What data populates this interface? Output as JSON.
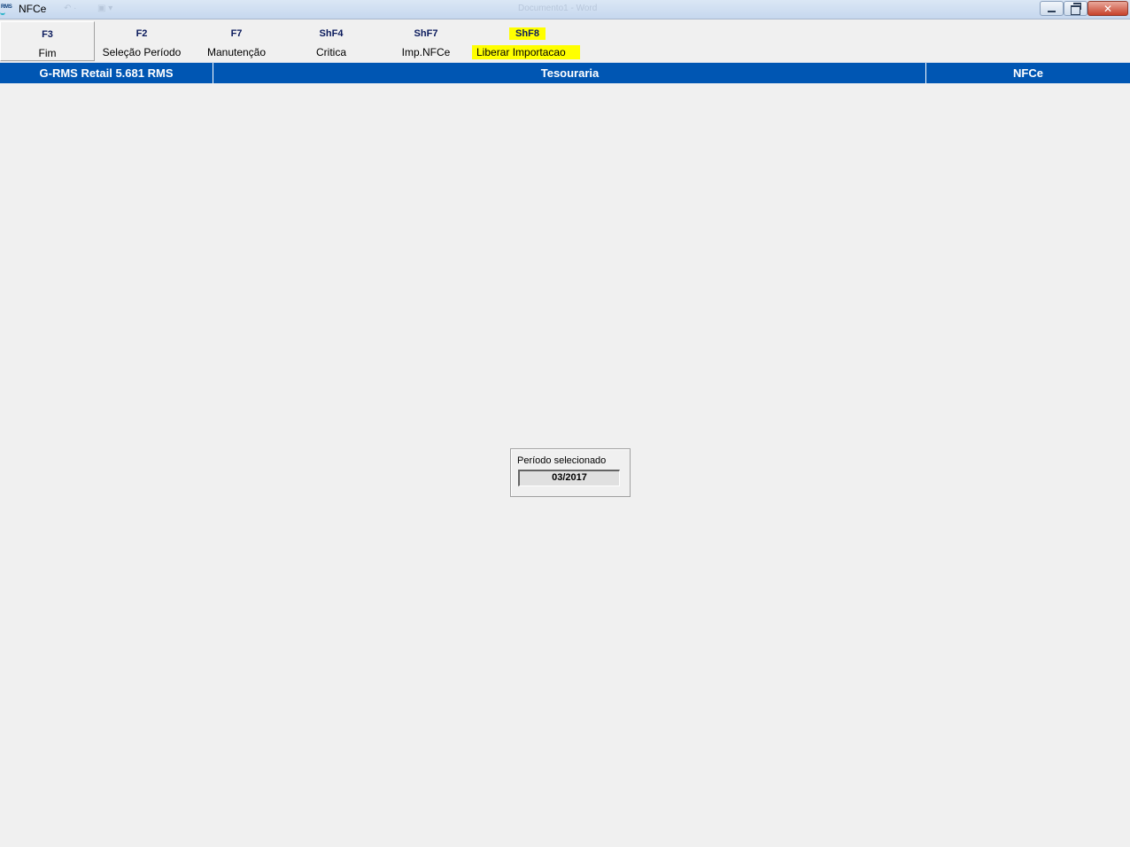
{
  "window": {
    "title": "NFCe",
    "logo_text": "RMS",
    "title_faint": "Documento1 - Word"
  },
  "toolbar": {
    "keys": [
      {
        "key": "F3",
        "label": "Fim",
        "active": true,
        "highlighted": false
      },
      {
        "key": "F2",
        "label": "Seleção Período",
        "active": false,
        "highlighted": false
      },
      {
        "key": "F7",
        "label": "Manutenção",
        "active": false,
        "highlighted": false
      },
      {
        "key": "ShF4",
        "label": "Critica",
        "active": false,
        "highlighted": false
      },
      {
        "key": "ShF7",
        "label": "Imp.NFCe",
        "active": false,
        "highlighted": false
      },
      {
        "key": "ShF8",
        "label": "Liberar Importacao",
        "active": false,
        "highlighted": true
      }
    ]
  },
  "header": {
    "system": "G-RMS Retail 5.681 RMS",
    "module": "Tesouraria",
    "program": "NFCe",
    "background_color": "#0056b3"
  },
  "period": {
    "label": "Período selecionado",
    "value": "03/2017"
  },
  "colors": {
    "highlight": "#ffff00",
    "key_text": "#0a1a5c"
  }
}
